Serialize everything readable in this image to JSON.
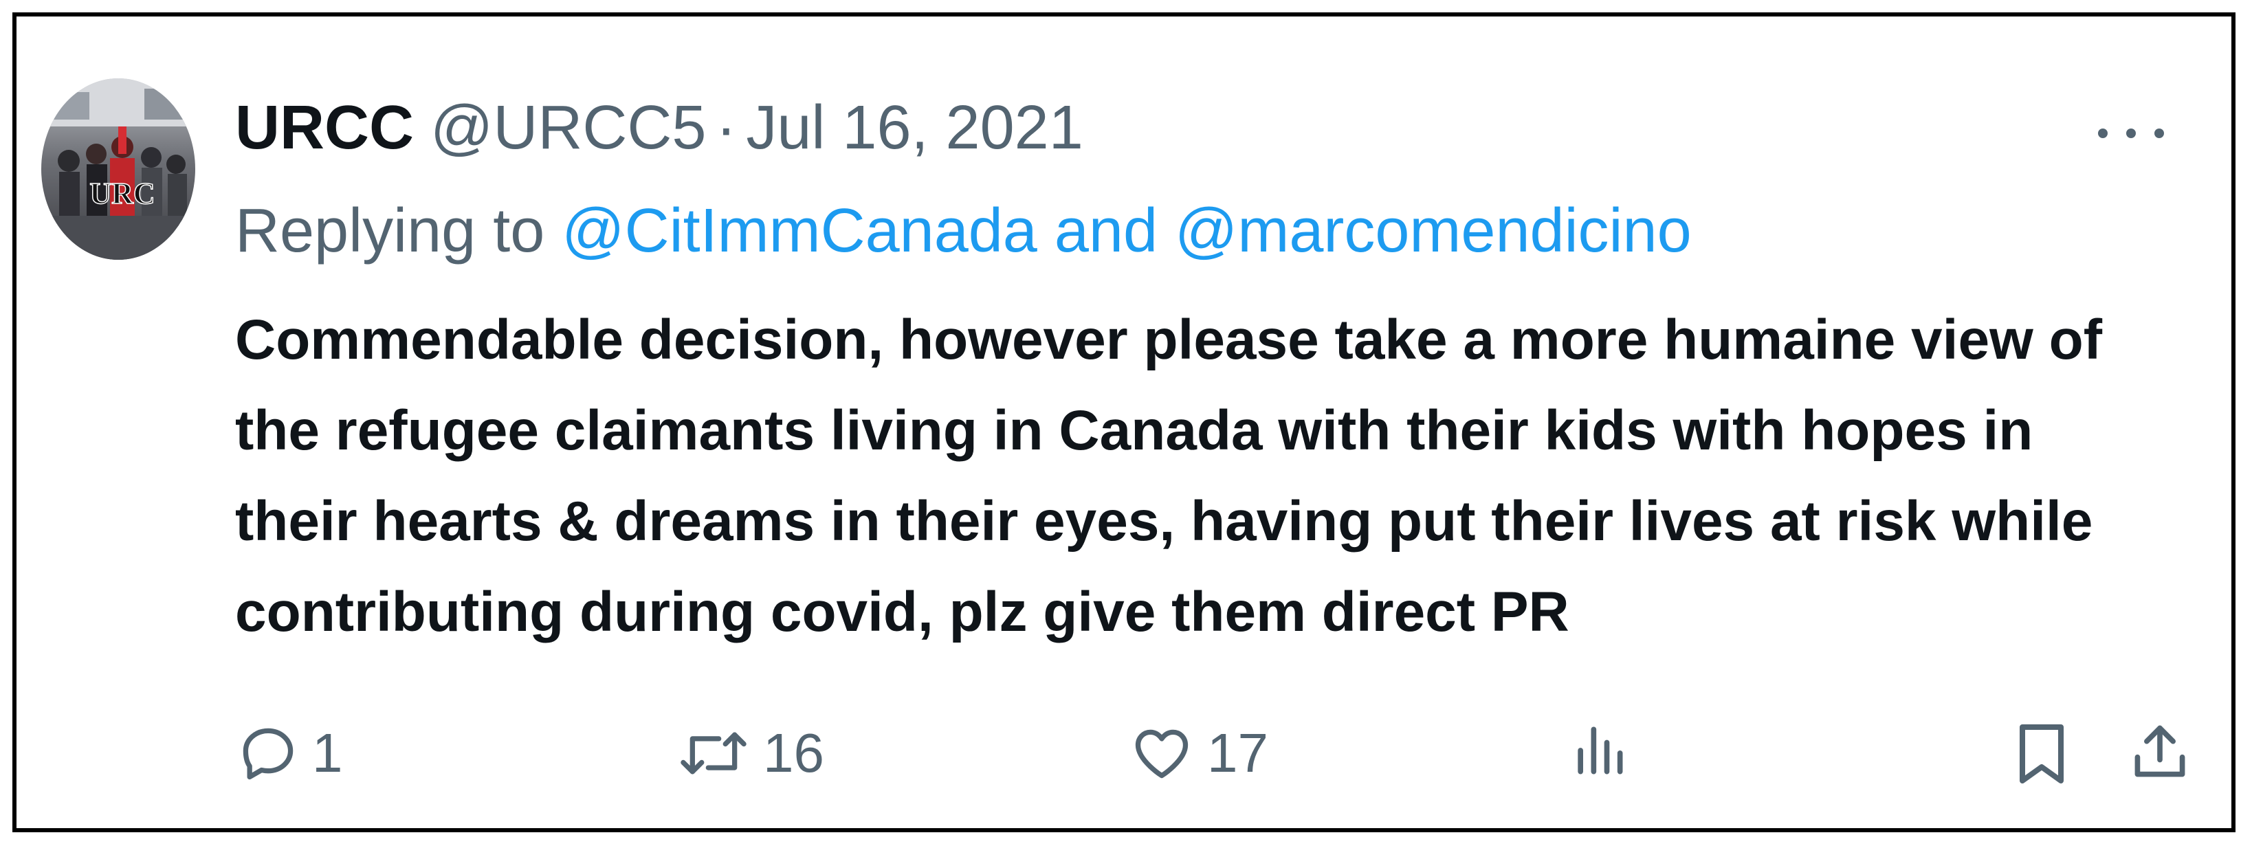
{
  "tweet": {
    "display_name": "URCC",
    "handle": "@URCC5",
    "separator": "·",
    "date": "Jul 16, 2021",
    "avatar_label": "URC",
    "replying_to_prefix": "Replying to",
    "replying_to_mentions": "@CitImmCanada and @marcomendicino",
    "text": "Commendable decision, however please take a  more humaine view of\nthe refugee claimants living in Canada with their kids with hopes in\ntheir hearts & dreams in their eyes, having put their lives at risk while\ncontributing during covid, plz give them direct PR"
  },
  "actions": {
    "reply_count": "1",
    "retweet_count": "16",
    "like_count": "17"
  },
  "icons": {
    "more": "more-options-icon",
    "reply": "reply-icon",
    "retweet": "retweet-icon",
    "like": "heart-icon",
    "views": "views-icon",
    "bookmark": "bookmark-icon",
    "share": "share-icon"
  },
  "colors": {
    "text_primary": "#0f1419",
    "text_secondary": "#536471",
    "link": "#1d9bf0",
    "border": "#000000"
  }
}
